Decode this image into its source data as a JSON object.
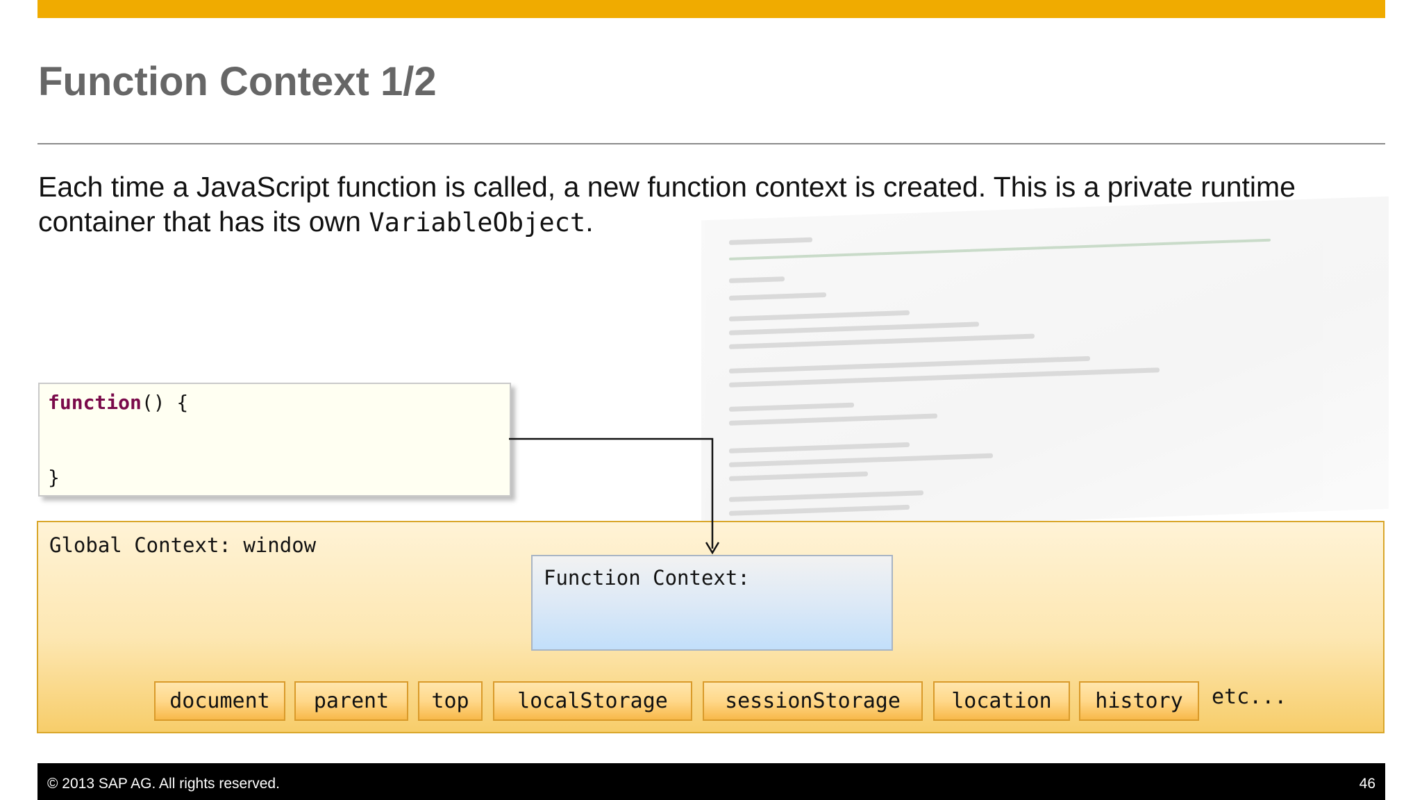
{
  "slide": {
    "title": "Function Context 1/2",
    "body_part1": "Each time a JavaScript function is called, a new function context is created.  This is a private runtime container that has its own ",
    "body_code": "VariableObject",
    "body_part2": "."
  },
  "code_box": {
    "keyword": "function",
    "line1_rest": "() {",
    "line2": "}"
  },
  "global_context": {
    "label": "Global Context: window",
    "function_context_label": "Function Context:",
    "properties": [
      "document",
      "parent",
      "top",
      "localStorage",
      "sessionStorage",
      "location",
      "history"
    ],
    "etc_label": "etc..."
  },
  "footer": {
    "copyright": "©  2013 SAP AG. All rights reserved.",
    "page_number": "46"
  },
  "colors": {
    "accent_bar": "#f0ab00",
    "title": "#666666",
    "keyword": "#7a0a4a"
  }
}
